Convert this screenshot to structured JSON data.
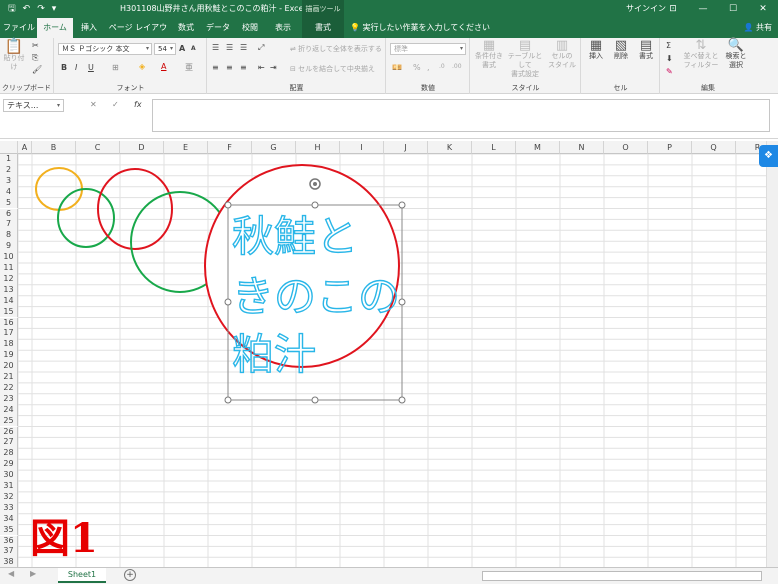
{
  "titlebar": {
    "title": "H301108山野井さん用秋鮭とこのこの粕汁  -  Excel",
    "drawing_tools": "描画ツール",
    "signin": "サインイン",
    "qat_save": "🖫",
    "qat_undo": "↶",
    "qat_redo": "↷",
    "qat_customize": "▾",
    "min": "—",
    "max": "☐",
    "close": "✕",
    "ribbon_opts": "⊡"
  },
  "tabs": [
    {
      "label": "ファイル"
    },
    {
      "label": "ホーム"
    },
    {
      "label": "挿入"
    },
    {
      "label": "ページ レイアウト"
    },
    {
      "label": "数式"
    },
    {
      "label": "データ"
    },
    {
      "label": "校閲"
    },
    {
      "label": "表示"
    },
    {
      "label": "書式"
    }
  ],
  "tellme": "実行したい作業を入力してください",
  "share": "共有",
  "ribbon": {
    "clipboard": {
      "label": "クリップボード",
      "paste": "貼り付け"
    },
    "font": {
      "label": "フォント",
      "name": "ＭＳ Ｐゴシック 本文",
      "size": "54",
      "bold": "B",
      "italic": "I",
      "underline": "U",
      "grow": "A",
      "shrink": "A"
    },
    "alignment": {
      "label": "配置",
      "wrap": "折り返して全体を表示する",
      "merge": "セルを結合して中央揃え"
    },
    "number": {
      "label": "数値",
      "format": "標準",
      "percent": "%"
    },
    "styles": {
      "label": "スタイル",
      "cond1": "条件付き",
      "cond2": "書式",
      "table1": "テーブルとして",
      "table2": "書式設定",
      "cell1": "セルの",
      "cell2": "スタイル"
    },
    "cells": {
      "label": "セル",
      "insert": "挿入",
      "delete": "削除",
      "format": "書式"
    },
    "editing": {
      "label": "編集",
      "sort1": "並べ替えと",
      "sort2": "フィルター",
      "find1": "検索と",
      "find2": "選択"
    }
  },
  "formula_bar": {
    "namebox": "テキス...",
    "cancel": "✕",
    "enter": "✓",
    "fx": "fx"
  },
  "grid": {
    "columns": [
      "A",
      "B",
      "C",
      "D",
      "E",
      "F",
      "G",
      "H",
      "I",
      "J",
      "K",
      "L",
      "M",
      "N",
      "O",
      "P",
      "Q",
      "R"
    ],
    "rows": [
      "1",
      "2",
      "3",
      "4",
      "5",
      "6",
      "7",
      "8",
      "9",
      "10",
      "11",
      "12",
      "13",
      "14",
      "15",
      "16",
      "17",
      "18",
      "19",
      "20",
      "21",
      "22",
      "23",
      "24",
      "25",
      "26",
      "27",
      "28",
      "29",
      "30",
      "31",
      "32",
      "33",
      "34",
      "35",
      "36",
      "37",
      "38"
    ]
  },
  "shape_text": {
    "line1": "秋鮭と",
    "line2": "きのこの",
    "line3": "粕汁"
  },
  "figure_label": "図1",
  "colors": {
    "excel_green": "#217346",
    "circle_yellow": "#f2b01e",
    "circle_green": "#18a84a",
    "circle_red": "#e0141e",
    "text_cyan": "#29b6e8",
    "label_red": "#e60000"
  },
  "sheets": [
    {
      "name": "Sheet1"
    }
  ],
  "sheetbar": {
    "add": "+",
    "prev": "◀",
    "next": "▶"
  },
  "dropbox_icon": "❖"
}
